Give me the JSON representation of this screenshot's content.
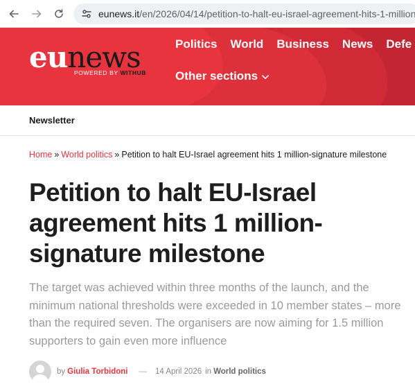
{
  "browser": {
    "url_host": "eunews.it",
    "url_path": "/en/2026/04/14/petition-to-halt-eu-israel-agreement-hits-1-million-"
  },
  "header": {
    "logo_eu": "eu",
    "logo_news": "news",
    "powered_prefix": "POWERED BY ",
    "powered_brand": "WITHUB",
    "brand_color": "#e8343f",
    "nav": [
      "Politics",
      "World",
      "Business",
      "News",
      "Defe"
    ],
    "other_sections": "Other sections"
  },
  "subnav": {
    "newsletter": "Newsletter"
  },
  "breadcrumb": {
    "home": "Home",
    "sep": "»",
    "section": "World politics",
    "current": "Petition to halt EU-Israel agreement hits 1 million-signature milestone"
  },
  "article": {
    "title": "Petition to halt EU-Israel agreement hits 1 million-signature milestone",
    "lead": "The target was achieved within three months of the launch, and the minimum national thresholds were exceeded in 10 member states – more than the required seven. The organisers are now aiming for 1.5 million supporters to gain even more influence",
    "by_prefix": "by",
    "author": "Giulia Torbidoni",
    "dash": "—",
    "date": "14 April 2026",
    "in_prefix": "in",
    "category": "World politics"
  }
}
